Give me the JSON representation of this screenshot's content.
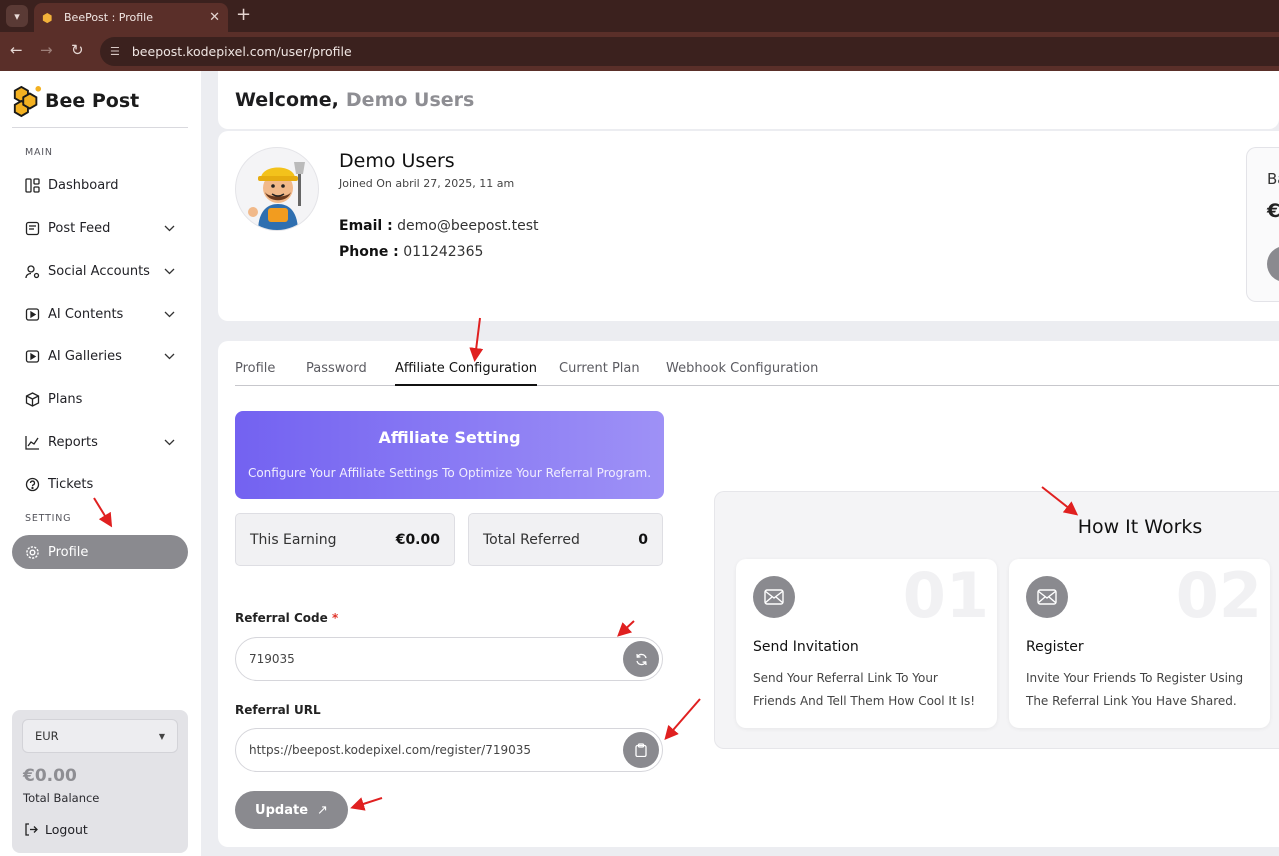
{
  "browser": {
    "tab_title": "BeePost : Profile",
    "new_tab": "+",
    "close": "✕",
    "url": "beepost.kodepixel.com/user/profile"
  },
  "sidebar": {
    "brand": "Bee Post",
    "section_main": "MAIN",
    "section_setting": "SETTING",
    "items": [
      {
        "label": "Dashboard",
        "icon": "dashboard-icon"
      },
      {
        "label": "Post Feed",
        "icon": "post-feed-icon"
      },
      {
        "label": "Social Accounts",
        "icon": "social-accounts-icon"
      },
      {
        "label": "AI Contents",
        "icon": "ai-contents-icon"
      },
      {
        "label": "AI Galleries",
        "icon": "ai-galleries-icon"
      },
      {
        "label": "Plans",
        "icon": "plans-icon"
      },
      {
        "label": "Reports",
        "icon": "reports-icon"
      },
      {
        "label": "Tickets",
        "icon": "tickets-icon"
      },
      {
        "label": "Profile",
        "icon": "gear-icon"
      }
    ],
    "currency": "EUR",
    "balance": "€0.00",
    "balance_label": "Total Balance",
    "logout": "Logout"
  },
  "header": {
    "welcome": "Welcome,",
    "user": "Demo Users"
  },
  "profile": {
    "name": "Demo Users",
    "joined": "Joined On abril 27, 2025, 11 am",
    "email_label": "Email :",
    "email": "demo@beepost.test",
    "phone_label": "Phone :",
    "phone": "011242365",
    "balance_peek_title": "Ba",
    "balance_peek_value": "€"
  },
  "tabs": [
    {
      "label": "Profile"
    },
    {
      "label": "Password"
    },
    {
      "label": "Affiliate Configuration"
    },
    {
      "label": "Current Plan"
    },
    {
      "label": "Webhook Configuration"
    }
  ],
  "affiliate": {
    "title": "Affiliate Setting",
    "subtitle": "Configure Your Affiliate Settings To Optimize Your Referral Program.",
    "earning_label": "This Earning",
    "earning_value": "€0.00",
    "referred_label": "Total Referred",
    "referred_value": "0",
    "code_label": "Referral Code",
    "required_mark": "*",
    "code_value": "719035",
    "url_label": "Referral URL",
    "url_value": "https://beepost.kodepixel.com/register/719035",
    "update_label": "Update",
    "update_arrow": "↗"
  },
  "how": {
    "title": "How It Works",
    "steps": [
      {
        "num": "01",
        "title": "Send Invitation",
        "desc": "Send Your Referral Link To Your Friends And Tell Them How Cool It Is!"
      },
      {
        "num": "02",
        "title": "Register",
        "desc": "Invite Your Friends To Register Using The Referral Link You Have Shared."
      }
    ]
  },
  "colors": {
    "accent_gray": "#8a8a8f",
    "banner_start": "#7362f1",
    "banner_end": "#9e91f6",
    "annotation_red": "#e02020",
    "chrome_dark": "#3b211e",
    "chrome_tab": "#5a2f29"
  }
}
